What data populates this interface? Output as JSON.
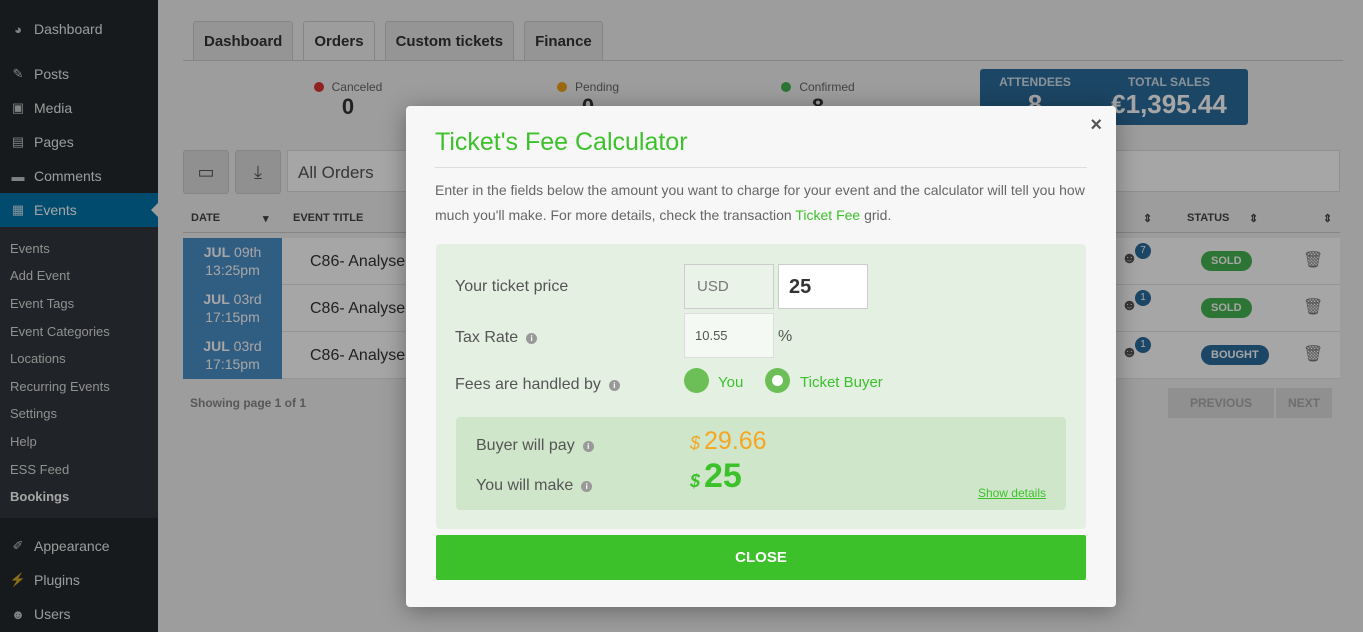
{
  "sidebar": {
    "items": [
      {
        "label": "Dashboard",
        "icon": "dashboard-icon"
      },
      {
        "label": "Posts",
        "icon": "pin-icon"
      },
      {
        "label": "Media",
        "icon": "media-icon"
      },
      {
        "label": "Pages",
        "icon": "pages-icon"
      },
      {
        "label": "Comments",
        "icon": "comment-icon"
      },
      {
        "label": "Events",
        "icon": "calendar-icon"
      }
    ],
    "sub_items": [
      "Events",
      "Add Event",
      "Event Tags",
      "Event Categories",
      "Locations",
      "Recurring Events",
      "Settings",
      "Help",
      "ESS Feed",
      "Bookings"
    ],
    "bottom_items": [
      {
        "label": "Appearance",
        "icon": "brush-icon"
      },
      {
        "label": "Plugins",
        "icon": "plug-icon"
      },
      {
        "label": "Users",
        "icon": "users-icon"
      }
    ]
  },
  "tabs": [
    "Dashboard",
    "Orders",
    "Custom tickets",
    "Finance"
  ],
  "stats": {
    "canceled": {
      "label": "Canceled",
      "value": "0",
      "color": "#dd3333"
    },
    "pending": {
      "label": "Pending",
      "value": "0",
      "color": "#f0a01c"
    },
    "confirmed": {
      "label": "Confirmed",
      "value": "8",
      "color": "#46b450"
    }
  },
  "summary": {
    "attendees_label": "ATTENDEES",
    "attendees_value": "8",
    "sales_label": "TOTAL SALES",
    "sales_value": "€1,395.44"
  },
  "filter": {
    "value": "All Orders"
  },
  "table": {
    "headers": {
      "date": "DATE",
      "event_title": "EVENT TITLE",
      "status": "STATUS"
    },
    "rows": [
      {
        "month_day": "JUL",
        "day": "09th",
        "time": "13:25pm",
        "title": "C86- Analyse",
        "count": "7",
        "status": "SOLD",
        "status_color": "#46b450"
      },
      {
        "month_day": "JUL",
        "day": "03rd",
        "time": "17:15pm",
        "title": "C86- Analyse",
        "count": "1",
        "status": "SOLD",
        "status_color": "#46b450"
      },
      {
        "month_day": "JUL",
        "day": "03rd",
        "time": "17:15pm",
        "title": "C86- Analyse",
        "count": "1",
        "status": "BOUGHT",
        "status_color": "#2b6c9c"
      }
    ],
    "page_info": "Showing page 1 of 1",
    "previous": "PREVIOUS",
    "next": "NEXT"
  },
  "modal": {
    "title": "Ticket's Fee Calculator",
    "close_x": "×",
    "description_before": "Enter in the fields below the amount you want to charge for your event and the calculator will tell you how much you'll make. For more details, check the transaction ",
    "description_link": "Ticket Fee",
    "description_after": " grid.",
    "price_label": "Your ticket price",
    "currency": "USD",
    "price_value": "25",
    "tax_label": "Tax Rate",
    "tax_value": "10.55",
    "percent": "%",
    "fees_label": "Fees are handled by",
    "option_you": "You",
    "option_buyer": "Ticket Buyer",
    "selected_option": "Ticket Buyer",
    "buyer_pays_label": "Buyer will pay",
    "buyer_pays_value": "29.66",
    "you_make_label": "You will make",
    "you_make_value": "25",
    "currency_symbol": "$",
    "show_details": "Show details",
    "close_button": "CLOSE",
    "accent_color": "#3cc12b"
  }
}
